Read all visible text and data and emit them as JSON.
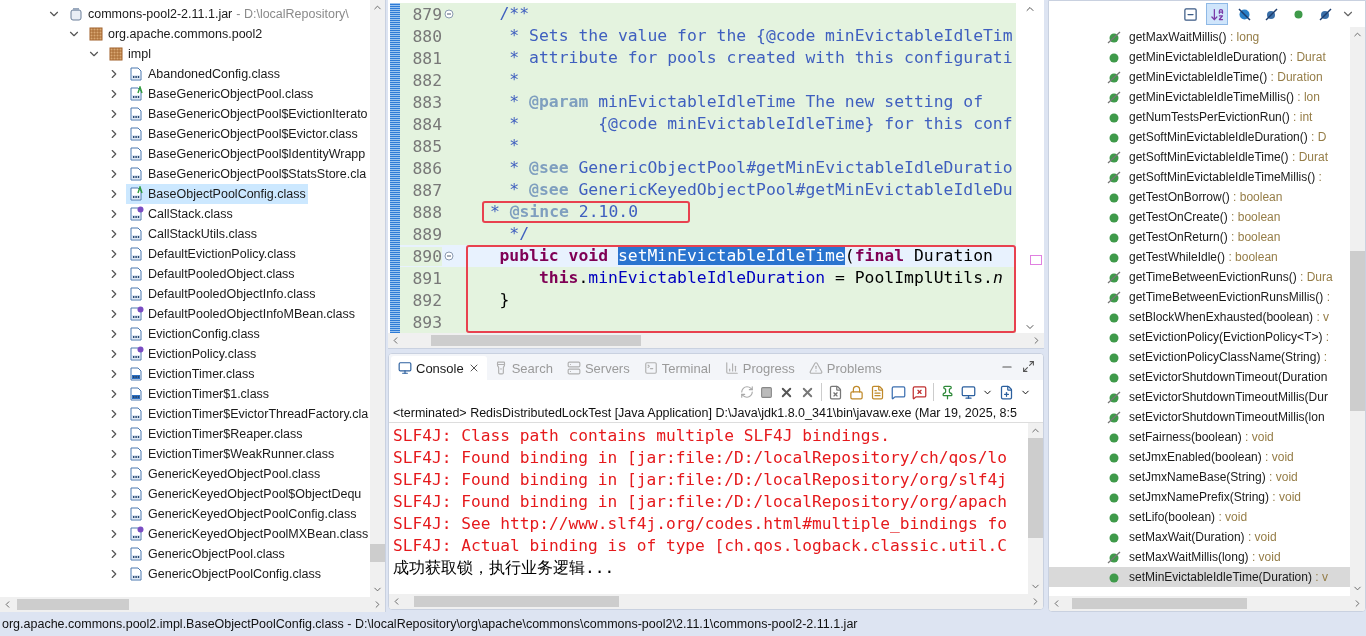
{
  "package_explorer": {
    "items": [
      {
        "label": "commons-pool2-2.11.1.jar",
        "decoration": "- D:\\localRepository\\",
        "kind": "jar",
        "expanded": true,
        "selected": false,
        "children": [
          {
            "label": "org.apache.commons.pool2",
            "kind": "package",
            "expanded": true,
            "selected": false,
            "children": [
              {
                "label": "impl",
                "kind": "package",
                "expanded": true,
                "selected": false,
                "children": [
                  {
                    "label": "AbandonedConfig.class",
                    "kind": "class",
                    "expanded": false,
                    "selected": false
                  },
                  {
                    "label": "BaseGenericObjectPool.class",
                    "kind": "abstract",
                    "expanded": false,
                    "selected": false
                  },
                  {
                    "label": "BaseGenericObjectPool$EvictionIterato",
                    "kind": "class",
                    "expanded": false,
                    "selected": false
                  },
                  {
                    "label": "BaseGenericObjectPool$Evictor.class",
                    "kind": "class",
                    "expanded": false,
                    "selected": false
                  },
                  {
                    "label": "BaseGenericObjectPool$IdentityWrapp",
                    "kind": "class",
                    "expanded": false,
                    "selected": false
                  },
                  {
                    "label": "BaseGenericObjectPool$StatsStore.cla",
                    "kind": "class",
                    "expanded": false,
                    "selected": false
                  },
                  {
                    "label": "BaseObjectPoolConfig.class",
                    "kind": "abstract",
                    "expanded": false,
                    "selected": true
                  },
                  {
                    "label": "CallStack.class",
                    "kind": "interface",
                    "expanded": false,
                    "selected": false
                  },
                  {
                    "label": "CallStackUtils.class",
                    "kind": "class",
                    "expanded": false,
                    "selected": false
                  },
                  {
                    "label": "DefaultEvictionPolicy.class",
                    "kind": "class",
                    "expanded": false,
                    "selected": false
                  },
                  {
                    "label": "DefaultPooledObject.class",
                    "kind": "class",
                    "expanded": false,
                    "selected": false
                  },
                  {
                    "label": "DefaultPooledObjectInfo.class",
                    "kind": "class",
                    "expanded": false,
                    "selected": false
                  },
                  {
                    "label": "DefaultPooledObjectInfoMBean.class",
                    "kind": "interface",
                    "expanded": false,
                    "selected": false
                  },
                  {
                    "label": "EvictionConfig.class",
                    "kind": "class",
                    "expanded": false,
                    "selected": false
                  },
                  {
                    "label": "EvictionPolicy.class",
                    "kind": "interface",
                    "expanded": false,
                    "selected": false
                  },
                  {
                    "label": "EvictionTimer.class",
                    "kind": "internal",
                    "expanded": false,
                    "selected": false
                  },
                  {
                    "label": "EvictionTimer$1.class",
                    "kind": "internal",
                    "expanded": false,
                    "selected": false
                  },
                  {
                    "label": "EvictionTimer$EvictorThreadFactory.cla",
                    "kind": "class",
                    "expanded": false,
                    "selected": false
                  },
                  {
                    "label": "EvictionTimer$Reaper.class",
                    "kind": "class",
                    "expanded": false,
                    "selected": false
                  },
                  {
                    "label": "EvictionTimer$WeakRunner.class",
                    "kind": "class",
                    "expanded": false,
                    "selected": false
                  },
                  {
                    "label": "GenericKeyedObjectPool.class",
                    "kind": "class",
                    "expanded": false,
                    "selected": false
                  },
                  {
                    "label": "GenericKeyedObjectPool$ObjectDequ",
                    "kind": "class",
                    "expanded": false,
                    "selected": false
                  },
                  {
                    "label": "GenericKeyedObjectPoolConfig.class",
                    "kind": "class",
                    "expanded": false,
                    "selected": false
                  },
                  {
                    "label": "GenericKeyedObjectPoolMXBean.class",
                    "kind": "interface",
                    "expanded": false,
                    "selected": false
                  },
                  {
                    "label": "GenericObjectPool.class",
                    "kind": "class",
                    "expanded": false,
                    "selected": false
                  },
                  {
                    "label": "GenericObjectPoolConfig.class",
                    "kind": "class",
                    "expanded": false,
                    "selected": false
                  }
                ]
              }
            ]
          }
        ]
      }
    ]
  },
  "editor": {
    "blocks": [
      {
        "kind": "plain",
        "lines": [
          {
            "number": "879",
            "fold": true,
            "current": false,
            "segments": [
              {
                "kind": "comment",
                "text": "    /**"
              }
            ]
          },
          {
            "number": "880",
            "fold": false,
            "current": false,
            "segments": [
              {
                "kind": "comment",
                "text": "     * Sets the value for the {@code minEvictableIdleTim"
              }
            ]
          },
          {
            "number": "881",
            "fold": false,
            "current": false,
            "segments": [
              {
                "kind": "comment",
                "text": "     * attribute for pools created with this configurati"
              }
            ]
          },
          {
            "number": "882",
            "fold": false,
            "current": false,
            "segments": [
              {
                "kind": "comment",
                "text": "     *"
              }
            ]
          },
          {
            "number": "883",
            "fold": false,
            "current": false,
            "segments": [
              {
                "kind": "comment",
                "text": "     * "
              },
              {
                "kind": "tag",
                "text": "@param"
              },
              {
                "kind": "comment",
                "text": " minEvictableIdleTime The new setting of"
              }
            ]
          },
          {
            "number": "884",
            "fold": false,
            "current": false,
            "segments": [
              {
                "kind": "comment",
                "text": "     *        {@code minEvictableIdleTime} for this conf"
              }
            ]
          },
          {
            "number": "885",
            "fold": false,
            "current": false,
            "segments": [
              {
                "kind": "comment",
                "text": "     *"
              }
            ]
          },
          {
            "number": "886",
            "fold": false,
            "current": false,
            "segments": [
              {
                "kind": "comment",
                "text": "     * "
              },
              {
                "kind": "tag",
                "text": "@see"
              },
              {
                "kind": "comment",
                "text": " GenericObjectPool#getMinEvictableIdleDuratio"
              }
            ]
          },
          {
            "number": "887",
            "fold": false,
            "current": false,
            "segments": [
              {
                "kind": "comment",
                "text": "     * "
              },
              {
                "kind": "tag",
                "text": "@see"
              },
              {
                "kind": "comment",
                "text": " GenericKeyedObjectPool#getMinEvictableIdleDu"
              }
            ]
          }
        ]
      },
      {
        "kind": "boxed-line",
        "lines": [
          {
            "number": "888",
            "fold": false,
            "current": false,
            "segments": [
              {
                "kind": "comment",
                "text": "* "
              },
              {
                "kind": "tag",
                "text": "@since"
              },
              {
                "kind": "comment",
                "text": " 2.10.0"
              }
            ]
          }
        ]
      },
      {
        "kind": "plain",
        "lines": [
          {
            "number": "889",
            "fold": false,
            "current": false,
            "segments": [
              {
                "kind": "comment",
                "text": "     */"
              }
            ]
          }
        ]
      },
      {
        "kind": "boxed-block",
        "lines": [
          {
            "number": "890",
            "fold": true,
            "current": true,
            "segments": [
              {
                "kind": "keyword",
                "text": "    public void "
              },
              {
                "kind": "selection",
                "text": "setMinEvictableIdleTime"
              },
              {
                "kind": "plain",
                "text": "("
              },
              {
                "kind": "keyword",
                "text": "final"
              },
              {
                "kind": "plain",
                "text": " Duration"
              }
            ]
          },
          {
            "number": "891",
            "fold": false,
            "current": false,
            "segments": [
              {
                "kind": "keyword",
                "text": "        this"
              },
              {
                "kind": "plain",
                "text": "."
              },
              {
                "kind": "field",
                "text": "minEvictableIdleDuration"
              },
              {
                "kind": "plain",
                "text": " = PoolImplUtils."
              },
              {
                "kind": "static",
                "text": "n"
              }
            ]
          },
          {
            "number": "892",
            "fold": false,
            "current": false,
            "segments": [
              {
                "kind": "plain",
                "text": "    }"
              }
            ]
          },
          {
            "number": "893",
            "fold": false,
            "current": false
          }
        ]
      }
    ]
  },
  "console": {
    "tabs": [
      {
        "label": "Console",
        "kind": "console",
        "selected": true
      },
      {
        "label": "Search",
        "kind": "search",
        "selected": false
      },
      {
        "label": "Servers",
        "kind": "servers",
        "selected": false
      },
      {
        "label": "Terminal",
        "kind": "terminal",
        "selected": false
      },
      {
        "label": "Progress",
        "kind": "progress",
        "selected": false
      },
      {
        "label": "Problems",
        "kind": "problems",
        "selected": false
      }
    ],
    "process": "<terminated> RedisDistributedLockTest [Java Application] D:\\Java\\jdk1.8.0_341\\bin\\javaw.exe (Mar 19, 2025, 8:5",
    "lines": [
      {
        "error": true,
        "text": "SLF4J: Class path contains multiple SLF4J bindings."
      },
      {
        "error": true,
        "text": "SLF4J: Found binding in [jar:file:/D:/localRepository/ch/qos/lo"
      },
      {
        "error": true,
        "text": "SLF4J: Found binding in [jar:file:/D:/localRepository/org/slf4j"
      },
      {
        "error": true,
        "text": "SLF4J: Found binding in [jar:file:/D:/localRepository/org/apach"
      },
      {
        "error": true,
        "text": "SLF4J: See http://www.slf4j.org/codes.html#multiple_bindings fo"
      },
      {
        "error": true,
        "text": "SLF4J: Actual binding is of type [ch.qos.logback.classic.util.C"
      },
      {
        "error": false,
        "text": "成功获取锁，执行业务逻辑..."
      }
    ]
  },
  "outline": {
    "tools": [
      {
        "kind": "collapse",
        "selected": false
      },
      {
        "kind": "sort",
        "selected": true
      },
      {
        "kind": "fields",
        "selected": false
      },
      {
        "kind": "static",
        "selected": false
      },
      {
        "kind": "nonpublic",
        "selected": false
      },
      {
        "kind": "local",
        "selected": false
      }
    ],
    "items": [
      {
        "name": "getMaxWaitMillis()",
        "type": " : long",
        "deprecated": true,
        "selected": false
      },
      {
        "name": "getMinEvictableIdleDuration()",
        "type": " : Durat",
        "deprecated": false,
        "selected": false
      },
      {
        "name": "getMinEvictableIdleTime()",
        "type": " : Duration",
        "deprecated": true,
        "selected": false
      },
      {
        "name": "getMinEvictableIdleTimeMillis()",
        "type": " : lon",
        "deprecated": true,
        "selected": false
      },
      {
        "name": "getNumTestsPerEvictionRun()",
        "type": " : int",
        "deprecated": false,
        "selected": false
      },
      {
        "name": "getSoftMinEvictableIdleDuration()",
        "type": " : D",
        "deprecated": false,
        "selected": false
      },
      {
        "name": "getSoftMinEvictableIdleTime()",
        "type": " : Durat",
        "deprecated": true,
        "selected": false
      },
      {
        "name": "getSoftMinEvictableIdleTimeMillis()",
        "type": " :",
        "deprecated": true,
        "selected": false
      },
      {
        "name": "getTestOnBorrow()",
        "type": " : boolean",
        "deprecated": false,
        "selected": false
      },
      {
        "name": "getTestOnCreate()",
        "type": " : boolean",
        "deprecated": false,
        "selected": false
      },
      {
        "name": "getTestOnReturn()",
        "type": " : boolean",
        "deprecated": false,
        "selected": false
      },
      {
        "name": "getTestWhileIdle()",
        "type": " : boolean",
        "deprecated": false,
        "selected": false
      },
      {
        "name": "getTimeBetweenEvictionRuns()",
        "type": " : Dura",
        "deprecated": true,
        "selected": false
      },
      {
        "name": "getTimeBetweenEvictionRunsMillis()",
        "type": " :",
        "deprecated": true,
        "selected": false
      },
      {
        "name": "setBlockWhenExhausted(boolean)",
        "type": " : v",
        "deprecated": false,
        "selected": false
      },
      {
        "name": "setEvictionPolicy(EvictionPolicy<T>)",
        "type": " :",
        "deprecated": false,
        "selected": false
      },
      {
        "name": "setEvictionPolicyClassName(String)",
        "type": " :",
        "deprecated": false,
        "selected": false
      },
      {
        "name": "setEvictorShutdownTimeout(Duration",
        "deprecated": false,
        "selected": false
      },
      {
        "name": "setEvictorShutdownTimeoutMillis(Dur",
        "deprecated": true,
        "selected": false
      },
      {
        "name": "setEvictorShutdownTimeoutMillis(lon",
        "deprecated": true,
        "selected": false
      },
      {
        "name": "setFairness(boolean)",
        "type": " : void",
        "deprecated": false,
        "selected": false
      },
      {
        "name": "setJmxEnabled(boolean)",
        "type": " : void",
        "deprecated": false,
        "selected": false
      },
      {
        "name": "setJmxNameBase(String)",
        "type": " : void",
        "deprecated": false,
        "selected": false
      },
      {
        "name": "setJmxNamePrefix(String)",
        "type": " : void",
        "deprecated": false,
        "selected": false
      },
      {
        "name": "setLifo(boolean)",
        "type": " : void",
        "deprecated": false,
        "selected": false
      },
      {
        "name": "setMaxWait(Duration)",
        "type": " : void",
        "deprecated": false,
        "selected": false
      },
      {
        "name": "setMaxWaitMillis(long)",
        "type": " : void",
        "deprecated": true,
        "selected": false
      },
      {
        "name": "setMinEvictableIdleTime(Duration)",
        "type": " : v",
        "deprecated": false,
        "selected": true
      }
    ]
  },
  "status_bar": "org.apache.commons.pool2.impl.BaseObjectPoolConfig.class - D:\\localRepository\\org\\apache\\commons\\commons-pool2\\2.11.1\\commons-pool2-2.11.1.jar"
}
